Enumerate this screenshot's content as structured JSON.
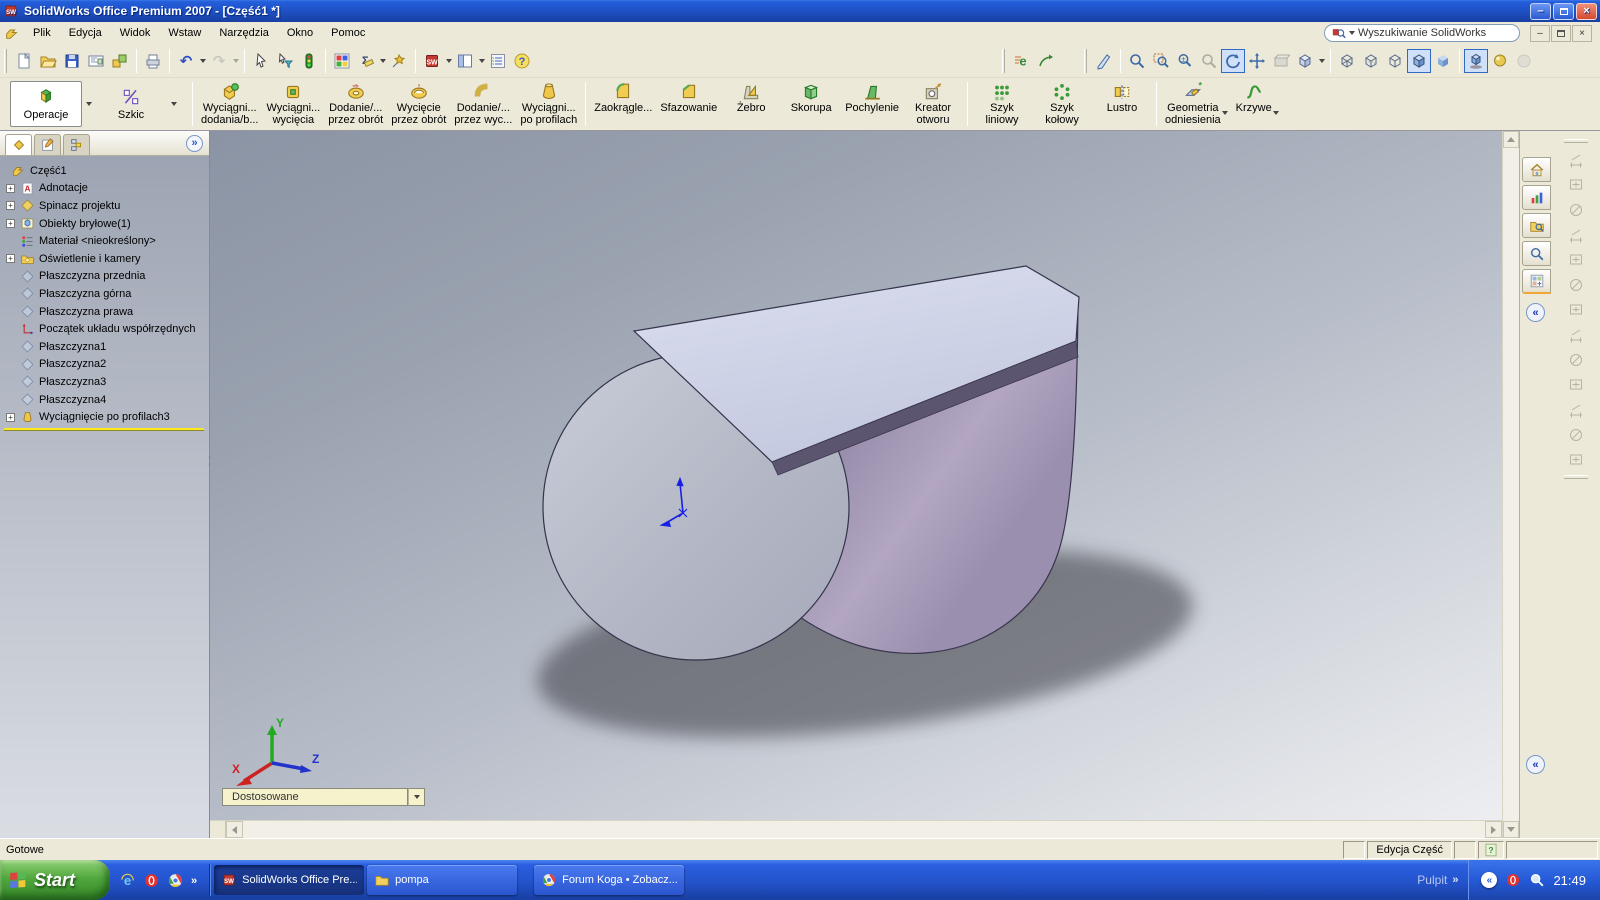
{
  "window": {
    "title": "SolidWorks Office Premium 2007 - [Część1 *]",
    "controls": [
      "minimize",
      "restore",
      "close"
    ]
  },
  "menu_bar": {
    "items": [
      "Plik",
      "Edycja",
      "Widok",
      "Wstaw",
      "Narzędzia",
      "Okno",
      "Pomoc"
    ],
    "search_placeholder": "Wyszukiwanie SolidWorks"
  },
  "toolbar": {
    "left_icons": [
      "new",
      "open",
      "save",
      "make-drawing-from-part",
      "make-assembly-from-part",
      "print",
      "undo",
      "redo",
      "select",
      "selection-filter",
      "rebuild",
      "edit-color",
      "measure",
      "solidworks-explorer",
      "solidworks",
      "panels",
      "options",
      "help"
    ],
    "right_icons": [
      "edrawings-publish",
      "edrawings-animate",
      "sketch-entity",
      "zoom-to-fit",
      "zoom-to-area",
      "zoom-in-out",
      "zoom-to-selection",
      "rotate-view",
      "pan",
      "section-view",
      "view-orientation",
      "wireframe",
      "hidden-lines-visible",
      "hidden-lines-removed",
      "shaded-with-edges",
      "shaded",
      "shadows-in-shaded-mode",
      "realview",
      "apply-scene"
    ]
  },
  "command_manager": {
    "tabs": [
      {
        "label": "Operacje",
        "active": true
      },
      {
        "label": "Szkic",
        "active": false
      }
    ],
    "buttons": [
      {
        "line1": "Wyciągni...",
        "line2": "dodania/b...",
        "icon": "boss"
      },
      {
        "line1": "Wyciągni...",
        "line2": "wycięcia",
        "icon": "cut"
      },
      {
        "line1": "Dodanie/...",
        "line2": "przez obrót",
        "icon": "revolve"
      },
      {
        "line1": "Wycięcie",
        "line2": "przez obrót",
        "icon": "revcut"
      },
      {
        "line1": "Dodanie/...",
        "line2": "przez wyc...",
        "icon": "sweep"
      },
      {
        "line1": "Wyciągni...",
        "line2": "po profilach",
        "icon": "loft"
      },
      {
        "line1": "Zaokrągle...",
        "line2": "",
        "icon": "fillet"
      },
      {
        "line1": "Sfazowanie",
        "line2": "",
        "icon": "chamfer"
      },
      {
        "line1": "Żebro",
        "line2": "",
        "icon": "rib"
      },
      {
        "line1": "Skorupa",
        "line2": "",
        "icon": "shell"
      },
      {
        "line1": "Pochylenie",
        "line2": "",
        "icon": "draft"
      },
      {
        "line1": "Kreator",
        "line2": "otworu",
        "icon": "holewiz"
      },
      {
        "line1": "Szyk",
        "line2": "liniowy",
        "icon": "linpat"
      },
      {
        "line1": "Szyk",
        "line2": "kołowy",
        "icon": "circpat"
      },
      {
        "line1": "Lustro",
        "line2": "",
        "icon": "mirror"
      },
      {
        "line1": "Geometria",
        "line2": "odniesienia",
        "icon": "refgeom"
      },
      {
        "line1": "Krzywe",
        "line2": "",
        "icon": "curves"
      }
    ]
  },
  "feature_tree": {
    "items": [
      {
        "label": "Część1",
        "icon": "t_part"
      },
      {
        "label": "Adnotacje",
        "icon": "t_annot",
        "expandable": true
      },
      {
        "label": "Spinacz projektu",
        "icon": "t_binder",
        "expandable": true
      },
      {
        "label": "Obiekty bryłowe(1)",
        "icon": "t_bodies",
        "expandable": true
      },
      {
        "label": "Materiał <nieokreślony>",
        "icon": "t_material"
      },
      {
        "label": "Oświetlenie i kamery",
        "icon": "t_lights",
        "expandable": true
      },
      {
        "label": "Płaszczyzna przednia",
        "icon": "t_plane"
      },
      {
        "label": "Płaszczyzna górna",
        "icon": "t_plane"
      },
      {
        "label": "Płaszczyzna prawa",
        "icon": "t_plane"
      },
      {
        "label": "Początek układu współrzędnych",
        "icon": "t_origin"
      },
      {
        "label": "Płaszczyzna1",
        "icon": "t_plane"
      },
      {
        "label": "Płaszczyzna2",
        "icon": "t_plane"
      },
      {
        "label": "Płaszczyzna3",
        "icon": "t_plane"
      },
      {
        "label": "Płaszczyzna4",
        "icon": "t_plane"
      },
      {
        "label": "Wyciągnięcie po profilach3",
        "icon": "t_loft",
        "expandable": true,
        "selected": true
      }
    ]
  },
  "viewport": {
    "config_selector": "Dostosowane",
    "triad_labels": {
      "x": "X",
      "y": "Y",
      "z": "Z"
    },
    "model": "lofted purple-gray solid with circular front face",
    "colors": {
      "background_top": "#8b94a4",
      "background_bottom": "#edeef1",
      "front_face": "#b4b8c6",
      "top_face": "#ccd1e6",
      "side_face": "#9d92b0",
      "origin_triad": "#1820e8"
    }
  },
  "task_pane": {
    "tabs": [
      "solidworks-resources",
      "design-library",
      "file-explorer",
      "search",
      "view-palette"
    ]
  },
  "status_bar": {
    "ready": "Gotowe",
    "mode": "Edycja Część"
  },
  "taskbar": {
    "start_label": "Start",
    "quick_launch": [
      "internet-explorer",
      "opera",
      "chrome"
    ],
    "windows": [
      {
        "label": "SolidWorks Office Pre...",
        "icon": "swcube",
        "active": true
      },
      {
        "label": "pompa",
        "icon": "folder",
        "active": false
      },
      {
        "label": "Forum Koga • Zobacz...",
        "icon": "chromeq",
        "active": false
      }
    ],
    "desktop_toolbar": "Pulpit",
    "clock": "21:49"
  },
  "colors": {
    "titlebar": "#245edb",
    "taskbar": "#2453cc",
    "start_green": "#51a83e",
    "panel_beige": "#ece9d8",
    "rollback_yellow": "#ffe818"
  }
}
